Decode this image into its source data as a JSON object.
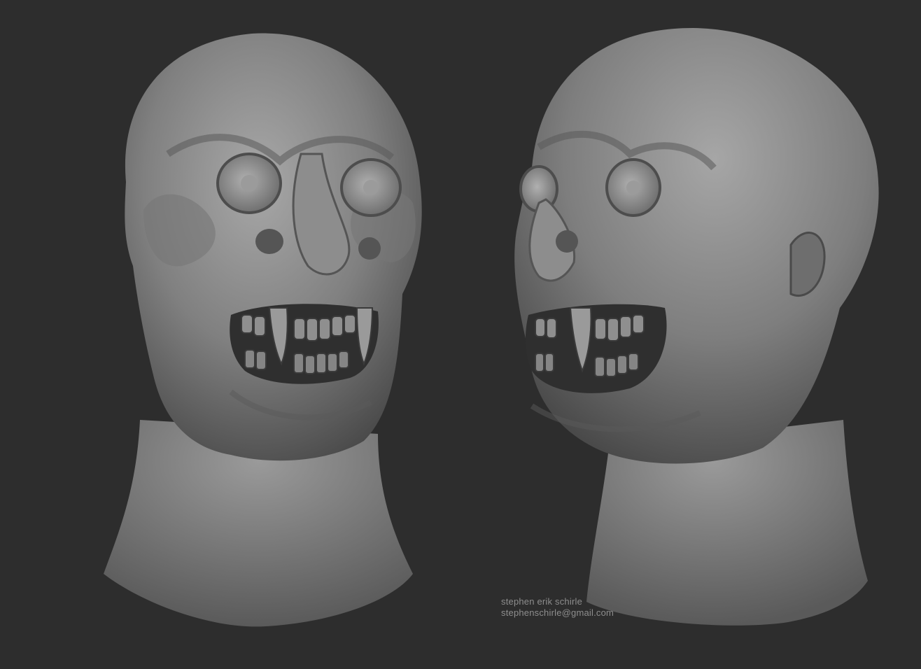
{
  "canvas": {
    "background": "#2d2d2d",
    "sculpt_color": "#8a8a8a"
  },
  "figures": [
    {
      "view": "front",
      "subject": "sculpted-creature-head"
    },
    {
      "view": "three-quarter",
      "subject": "sculpted-creature-head"
    }
  ],
  "credits": {
    "name": "stephen erik schirle",
    "email": "stephenschirle@gmail.com"
  }
}
